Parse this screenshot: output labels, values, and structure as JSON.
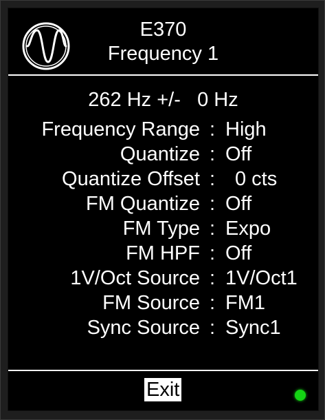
{
  "header": {
    "logo_icon": "sine-wave-icon",
    "module": "E370",
    "page": "Frequency 1"
  },
  "frequency": {
    "value": "262 Hz +/-",
    "offset": "0 Hz"
  },
  "params": [
    {
      "label": "Frequency Range",
      "value": "High"
    },
    {
      "label": "Quantize",
      "value": "Off"
    },
    {
      "label": "Quantize Offset",
      "value": "0 cts"
    },
    {
      "label": "FM Quantize",
      "value": "Off"
    },
    {
      "label": "FM Type",
      "value": "Expo"
    },
    {
      "label": "FM HPF",
      "value": "Off"
    },
    {
      "label": "1V/Oct Source",
      "value": "1V/Oct1"
    },
    {
      "label": "FM Source",
      "value": "FM1"
    },
    {
      "label": "Sync Source",
      "value": "Sync1"
    }
  ],
  "separator": ":",
  "footer": {
    "exit_label": "Exit",
    "status_led_color": "#14d414"
  }
}
